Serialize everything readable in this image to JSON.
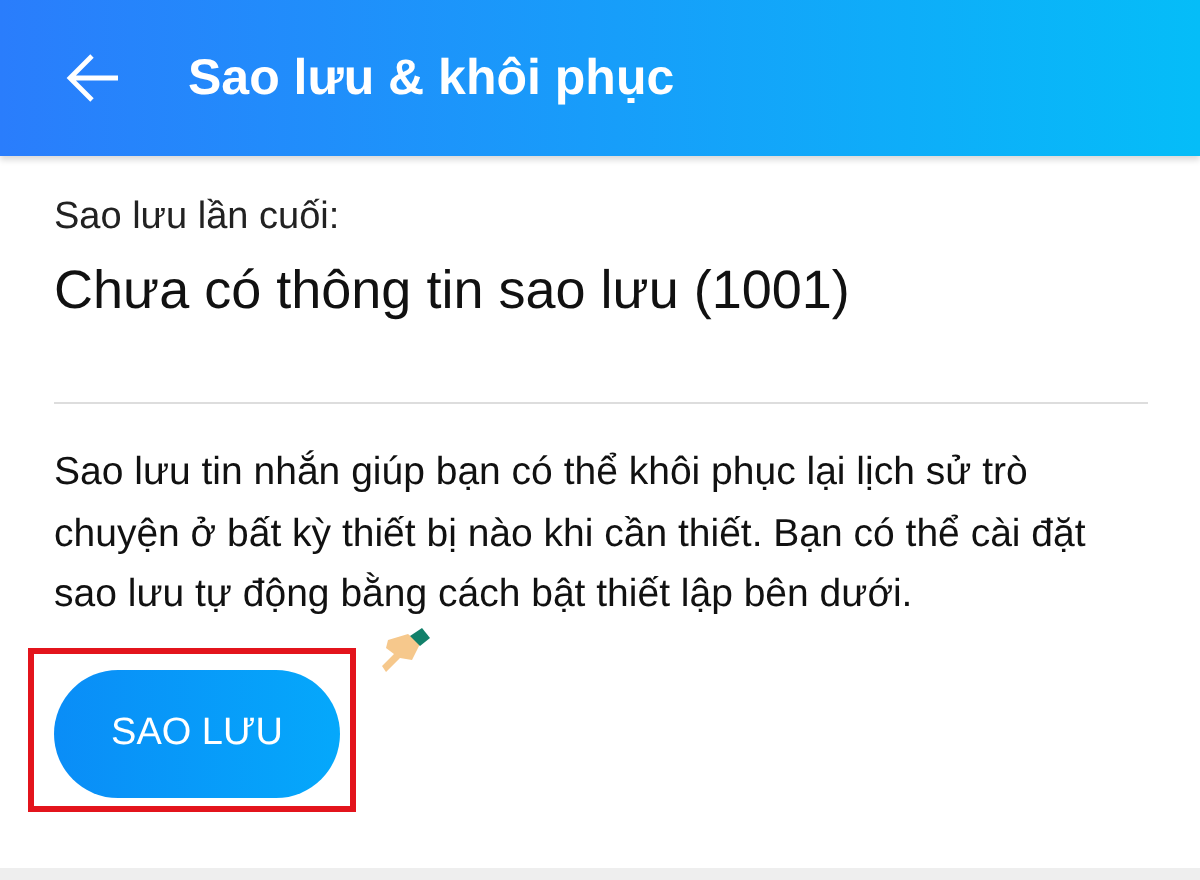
{
  "header": {
    "title": "Sao lưu & khôi phục"
  },
  "last_backup": {
    "label": "Sao lưu lần cuối:",
    "value": "Chưa có thông tin sao lưu (1001)"
  },
  "description": "Sao lưu tin nhắn giúp bạn có thể khôi phục lại lịch sử trò chuyện ở bất kỳ thiết bị nào khi cần thiết. Bạn có thể cài đặt sao lưu tự động bằng cách bật thiết lập bên dưới.",
  "backup_button": {
    "label": "SAO LƯU"
  }
}
